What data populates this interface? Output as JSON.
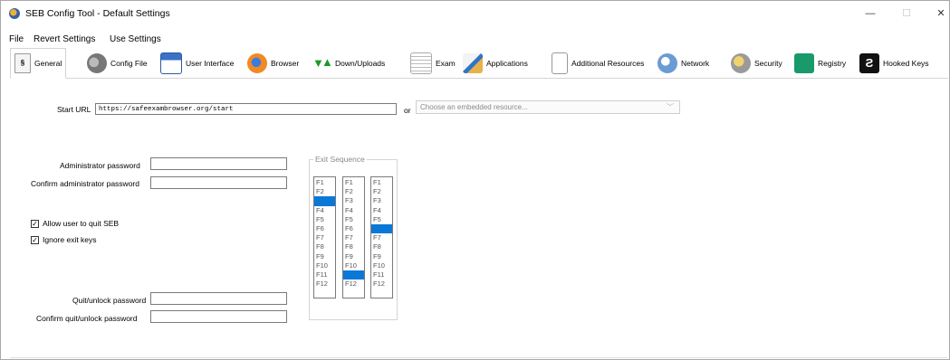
{
  "window": {
    "title": "SEB Config Tool - Default Settings",
    "controls": {
      "minimize": "—",
      "maximize": "☐",
      "close": "✕"
    }
  },
  "menu": [
    "File",
    "Revert Settings",
    "Use Settings"
  ],
  "tabs": [
    {
      "label": "General",
      "icon": "general-icon",
      "active": true
    },
    {
      "label": "Config File",
      "icon": "config-file-icon"
    },
    {
      "label": "User Interface",
      "icon": "user-interface-icon"
    },
    {
      "label": "Browser",
      "icon": "browser-icon"
    },
    {
      "label": "Down/Uploads",
      "icon": "down-uploads-icon"
    },
    {
      "label": "Exam",
      "icon": "exam-icon"
    },
    {
      "label": "Applications",
      "icon": "applications-icon"
    },
    {
      "label": "Additional Resources",
      "icon": "additional-resources-icon"
    },
    {
      "label": "Network",
      "icon": "network-icon"
    },
    {
      "label": "Security",
      "icon": "security-icon"
    },
    {
      "label": "Registry",
      "icon": "registry-icon"
    },
    {
      "label": "Hooked Keys",
      "icon": "hooked-keys-icon"
    }
  ],
  "general": {
    "start_url_label": "Start URL",
    "start_url_value": "https://safeexambrowser.org/start",
    "or_label": "or",
    "embedded_placeholder": "Choose an embedded resource...",
    "admin_password_label": "Administrator password",
    "confirm_admin_password_label": "Confirm administrator password",
    "allow_quit_label": "Allow user to quit SEB",
    "allow_quit_checked": true,
    "ignore_exit_keys_label": "Ignore exit keys",
    "ignore_exit_keys_checked": true,
    "quit_password_label": "Quit/unlock password",
    "confirm_quit_password_label": "Confirm quit/unlock password",
    "exit_sequence_title": "Exit Sequence",
    "exit_keys": [
      "F1",
      "F2",
      "F3",
      "F4",
      "F5",
      "F6",
      "F7",
      "F8",
      "F9",
      "F10",
      "F11",
      "F12"
    ],
    "exit_sequence_selected": [
      "F3",
      "F11",
      "F6"
    ]
  }
}
